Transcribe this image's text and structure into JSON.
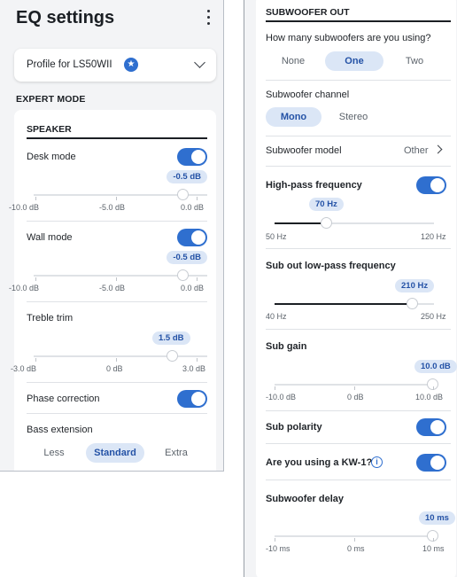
{
  "header": {
    "title": "EQ settings",
    "menu_icon": "more-vert-icon"
  },
  "profile": {
    "label": "Profile for LS50WII",
    "badge_icon": "star-badge-icon",
    "chevron_icon": "chevron-down-icon"
  },
  "expert_mode": {
    "label": "EXPERT MODE",
    "speaker": {
      "label": "SPEAKER",
      "desk_mode": {
        "label": "Desk mode",
        "enabled": true,
        "value": "-0.5 dB",
        "level": 0.95,
        "min": "-10.0 dB",
        "mid": "-5.0 dB",
        "max": "0.0 dB"
      },
      "wall_mode": {
        "label": "Wall mode",
        "enabled": true,
        "value": "-0.5 dB",
        "level": 0.95,
        "min": "-10.0 dB",
        "mid": "-5.0 dB",
        "max": "0.0 dB"
      },
      "treble_trim": {
        "label": "Treble trim",
        "value": "1.5 dB",
        "level": 0.75,
        "min": "-3.0 dB",
        "mid": "0 dB",
        "max": "3.0 dB"
      },
      "phase_correction": {
        "label": "Phase correction",
        "enabled": true
      },
      "bass_extension": {
        "label": "Bass extension",
        "options": [
          "Less",
          "Standard",
          "Extra"
        ],
        "selected": "Standard"
      }
    }
  },
  "subwoofer_out": {
    "label": "SUBWOOFER OUT",
    "count": {
      "question": "How many subwoofers are you using?",
      "options": [
        "None",
        "One",
        "Two"
      ],
      "selected": "One"
    },
    "channel": {
      "label": "Subwoofer channel",
      "options": [
        "Mono",
        "Stereo"
      ],
      "selected": "Mono"
    },
    "model": {
      "label": "Subwoofer model",
      "value": "Other",
      "chevron_icon": "chevron-right-icon"
    },
    "high_pass": {
      "label": "High-pass frequency",
      "enabled": true,
      "value": "70 Hz",
      "level": 0.29,
      "min": "50 Hz",
      "max": "120 Hz"
    },
    "low_pass": {
      "label": "Sub out low-pass frequency",
      "value": "210 Hz",
      "level": 0.8,
      "min": "40 Hz",
      "max": "250 Hz"
    },
    "gain": {
      "label": "Sub gain",
      "value": "10.0 dB",
      "level": 1.0,
      "min": "-10.0 dB",
      "mid": "0 dB",
      "max": "10.0 dB"
    },
    "polarity": {
      "label": "Sub polarity",
      "enabled": true
    },
    "kw1": {
      "label": "Are you using a KW-1?",
      "enabled": true,
      "info_icon": "info-icon"
    },
    "delay": {
      "label": "Subwoofer delay",
      "value": "10 ms",
      "level": 1.0,
      "min": "-10 ms",
      "mid": "0 ms",
      "max": "10 ms"
    }
  }
}
